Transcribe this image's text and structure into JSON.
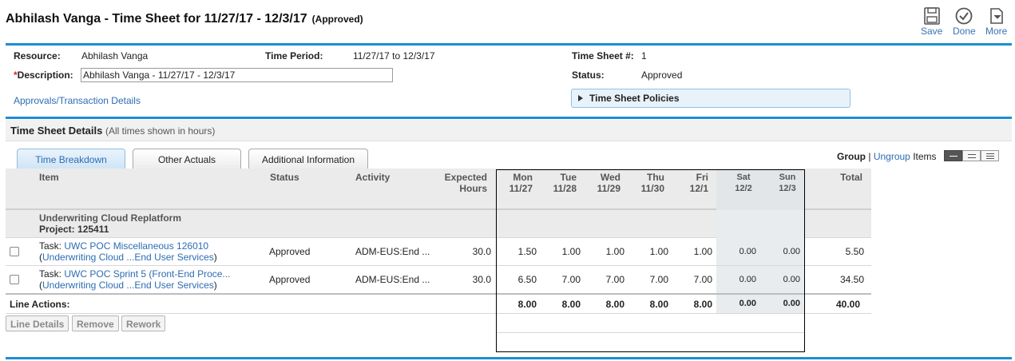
{
  "header": {
    "title": "Abhilash Vanga - Time Sheet for 11/27/17 - 12/3/17",
    "status_suffix": "(Approved)",
    "toolbar": {
      "save": "Save",
      "done": "Done",
      "more": "More"
    }
  },
  "info": {
    "resource_label": "Resource:",
    "resource_value": "Abhilash Vanga",
    "time_period_label": "Time Period:",
    "time_period_value": "11/27/17 to 12/3/17",
    "timesheet_no_label": "Time Sheet #:",
    "timesheet_no_value": "1",
    "description_required": "*",
    "description_label": "Description:",
    "description_value": "Abhilash Vanga - 11/27/17 - 12/3/17",
    "status_label": "Status:",
    "status_value": "Approved",
    "approvals_link": "Approvals/Transaction Details",
    "policies_label": "Time Sheet Policies"
  },
  "details": {
    "title": "Time Sheet Details",
    "note": "(All times shown in hours)"
  },
  "tabs": [
    {
      "label": "Time Breakdown",
      "active": true
    },
    {
      "label": "Other Actuals",
      "active": false
    },
    {
      "label": "Additional Information",
      "active": false
    }
  ],
  "grouping": {
    "group": "Group",
    "sep": "|",
    "ungroup": "Ungroup",
    "items": "Items"
  },
  "grid": {
    "columns": {
      "item": "Item",
      "status": "Status",
      "activity": "Activity",
      "expected_1": "Expected",
      "expected_2": "Hours",
      "days": [
        {
          "day": "Mon",
          "date": "11/27"
        },
        {
          "day": "Tue",
          "date": "11/28"
        },
        {
          "day": "Wed",
          "date": "11/29"
        },
        {
          "day": "Thu",
          "date": "11/30"
        },
        {
          "day": "Fri",
          "date": "12/1"
        },
        {
          "day": "Sat",
          "date": "12/2"
        },
        {
          "day": "Sun",
          "date": "12/3"
        }
      ],
      "total": "Total"
    },
    "group": {
      "name": "Underwriting Cloud Replatform",
      "project_label": "Project:",
      "project_id": "125411"
    },
    "rows": [
      {
        "task_prefix": "Task:",
        "task_name": "UWC POC Miscellaneous 126010",
        "open_paren": "(",
        "sub_link": "Underwriting Cloud ...End User Services",
        "close_paren": ")",
        "status": "Approved",
        "activity": "ADM-EUS:End ...",
        "expected": "30.0",
        "hours": [
          "1.50",
          "1.00",
          "1.00",
          "1.00",
          "1.00",
          "0.00",
          "0.00"
        ],
        "total": "5.50"
      },
      {
        "task_prefix": "Task:",
        "task_name": "UWC POC Sprint 5 (Front-End Proce...",
        "open_paren": "(",
        "sub_link": "Underwriting Cloud ...End User Services",
        "close_paren": ")",
        "status": "Approved",
        "activity": "ADM-EUS:End ...",
        "expected": "30.0",
        "hours": [
          "6.50",
          "7.00",
          "7.00",
          "7.00",
          "7.00",
          "0.00",
          "0.00"
        ],
        "total": "34.50"
      }
    ],
    "totals": {
      "label": "Line Actions:",
      "hours": [
        "8.00",
        "8.00",
        "8.00",
        "8.00",
        "8.00",
        "0.00",
        "0.00"
      ],
      "total": "40.00"
    }
  },
  "line_buttons": {
    "details": "Line Details",
    "remove": "Remove",
    "rework": "Rework"
  },
  "colors": {
    "accent": "#1d8ed1",
    "link": "#2d6cb3",
    "required": "#d9230f"
  },
  "icons": {
    "save": "floppy-disk-icon",
    "done": "check-circle-icon",
    "more": "more-menu-icon"
  }
}
